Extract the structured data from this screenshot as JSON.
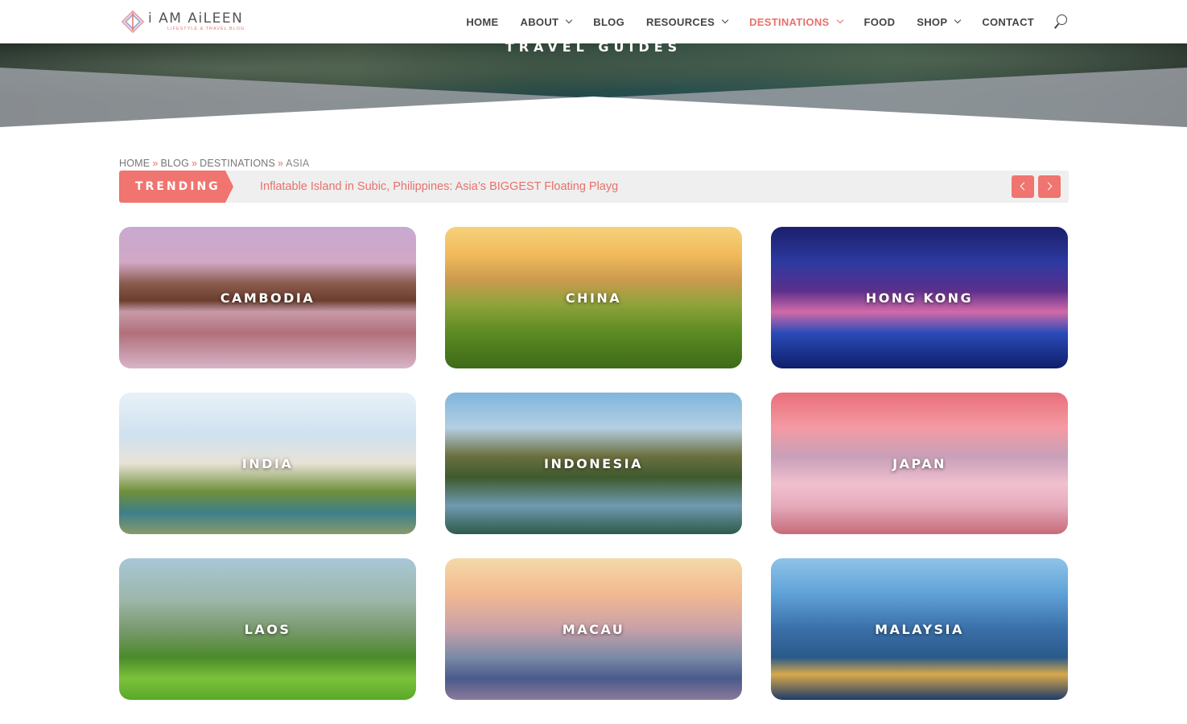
{
  "header": {
    "logo": {
      "main": "i AM AiLEEN",
      "tagline": "LIFESTYLE & TRAVEL BLOG"
    },
    "nav": [
      {
        "label": "HOME",
        "dropdown": false,
        "active": false
      },
      {
        "label": "ABOUT",
        "dropdown": true,
        "active": false
      },
      {
        "label": "BLOG",
        "dropdown": false,
        "active": false
      },
      {
        "label": "RESOURCES",
        "dropdown": true,
        "active": false
      },
      {
        "label": "DESTINATIONS",
        "dropdown": true,
        "active": true
      },
      {
        "label": "FOOD",
        "dropdown": false,
        "active": false
      },
      {
        "label": "SHOP",
        "dropdown": true,
        "active": false
      },
      {
        "label": "CONTACT",
        "dropdown": false,
        "active": false
      }
    ],
    "search_icon": "search-icon",
    "accent_color": "#e8716b"
  },
  "hero": {
    "title": "TRAVEL GUIDES"
  },
  "breadcrumb": {
    "items": [
      "HOME",
      "BLOG",
      "DESTINATIONS"
    ],
    "separator": "»",
    "current": "ASIA"
  },
  "trending": {
    "label": "TRENDING",
    "headline": "Inflatable Island in Subic, Philippines: Asia’s BIGGEST Floating Playg",
    "prev_icon": "chevron-left-icon",
    "next_icon": "chevron-right-icon"
  },
  "destinations": [
    {
      "name": "CAMBODIA",
      "key": "cambodia"
    },
    {
      "name": "CHINA",
      "key": "china"
    },
    {
      "name": "HONG KONG",
      "key": "hongkong"
    },
    {
      "name": "INDIA",
      "key": "india"
    },
    {
      "name": "INDONESIA",
      "key": "indonesia"
    },
    {
      "name": "JAPAN",
      "key": "japan"
    },
    {
      "name": "LAOS",
      "key": "laos"
    },
    {
      "name": "MACAU",
      "key": "macau"
    },
    {
      "name": "MALAYSIA",
      "key": "malaysia"
    }
  ]
}
